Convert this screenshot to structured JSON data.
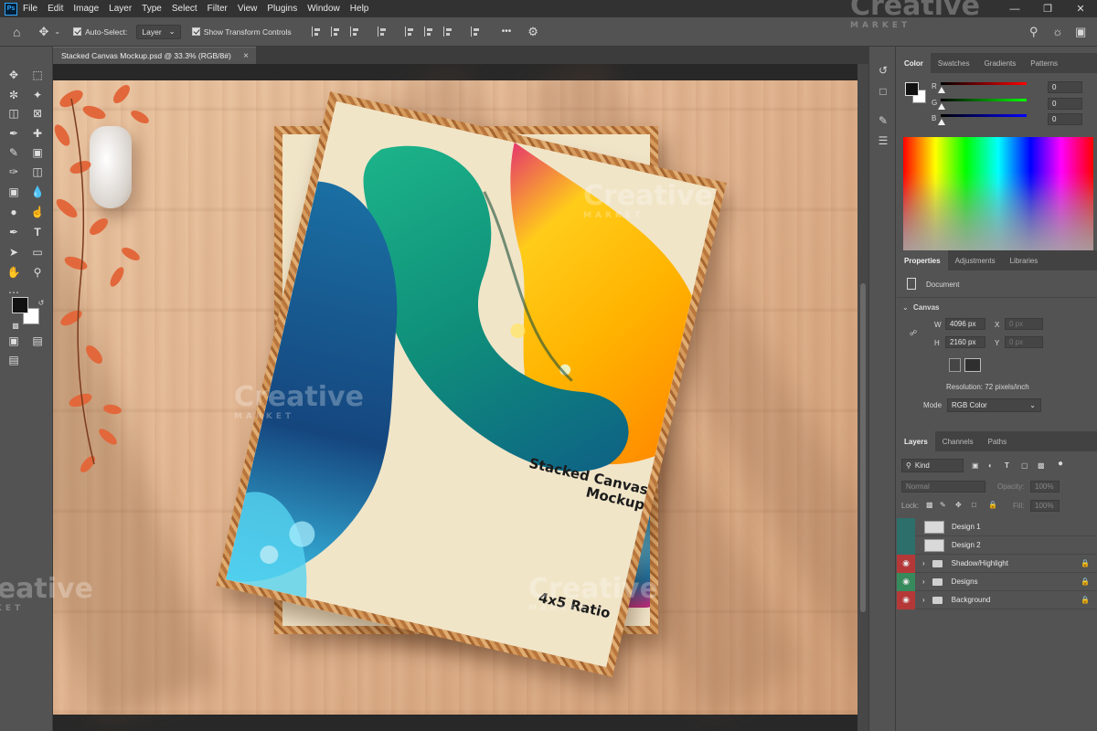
{
  "menubar": {
    "logo": "Ps",
    "items": [
      "File",
      "Edit",
      "Image",
      "Layer",
      "Type",
      "Select",
      "Filter",
      "View",
      "Plugins",
      "Window",
      "Help"
    ]
  },
  "options": {
    "auto_select_label": "Auto-Select:",
    "auto_select_target": "Layer",
    "show_transform_label": "Show Transform Controls",
    "more": "•••"
  },
  "document": {
    "tab_title": "Stacked Canvas Mockup.psd @ 33.3% (RGB/8#)",
    "close": "×"
  },
  "artwork": {
    "title_line1": "Stacked Canvas",
    "title_line2": "Mockup",
    "ratio": "4x5 Ratio"
  },
  "watermark": {
    "brand": "Creative",
    "sub": "MARKET"
  },
  "color_panel": {
    "tabs": [
      "Color",
      "Swatches",
      "Gradients",
      "Patterns"
    ],
    "r_label": "R",
    "g_label": "G",
    "b_label": "B",
    "r_value": "0",
    "g_value": "0",
    "b_value": "0"
  },
  "properties_panel": {
    "tabs": [
      "Properties",
      "Adjustments",
      "Libraries"
    ],
    "doc_label": "Document",
    "section": "Canvas",
    "w_label": "W",
    "w_value": "4096 px",
    "h_label": "H",
    "h_value": "2160 px",
    "x_label": "X",
    "x_value": "0 px",
    "y_label": "Y",
    "y_value": "0 px",
    "resolution": "Resolution: 72 pixels/inch",
    "mode_label": "Mode",
    "mode_value": "RGB Color"
  },
  "layers_panel": {
    "tabs": [
      "Layers",
      "Channels",
      "Paths"
    ],
    "kind": "Kind",
    "blend": "Normal",
    "opacity_label": "Opacity:",
    "opacity_value": "100%",
    "lock_label": "Lock:",
    "fill_label": "Fill:",
    "fill_value": "100%",
    "layers": [
      {
        "name": "Design 1",
        "type": "smart",
        "eye": "blank"
      },
      {
        "name": "Design 2",
        "type": "smart",
        "eye": "blank"
      },
      {
        "name": "Shadow/Highlight",
        "type": "folder",
        "eye": "red"
      },
      {
        "name": "Designs",
        "type": "folder",
        "eye": "green"
      },
      {
        "name": "Background",
        "type": "folder",
        "eye": "red"
      }
    ]
  },
  "colors": {
    "accent_ps": "#31a8ff",
    "eye_red": "#b53838",
    "eye_green": "#368a5c"
  }
}
